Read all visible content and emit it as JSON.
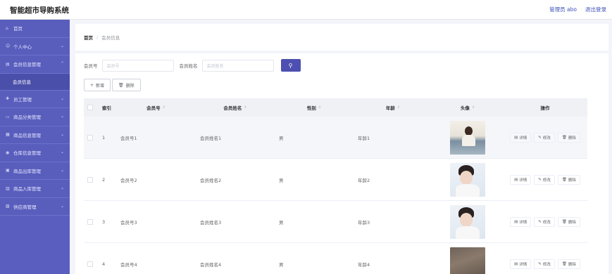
{
  "header": {
    "app_title": "智能超市导购系统",
    "admin_label": "管理员 abo",
    "logout_label": "退出登录"
  },
  "sidebar": {
    "items": [
      {
        "label": "首页",
        "icon": "home-icon",
        "has_chevron": false
      },
      {
        "label": "个人中心",
        "icon": "user-icon",
        "has_chevron": true
      },
      {
        "label": "会员信息管理",
        "icon": "list-icon",
        "has_chevron": true,
        "expanded": true
      },
      {
        "label": "员工管理",
        "icon": "staff-icon",
        "has_chevron": true
      },
      {
        "label": "商品分类管理",
        "icon": "category-icon",
        "has_chevron": true
      },
      {
        "label": "商品信息管理",
        "icon": "grid-icon",
        "has_chevron": true
      },
      {
        "label": "仓库信息管理",
        "icon": "warehouse-icon",
        "has_chevron": true
      },
      {
        "label": "商品出库管理",
        "icon": "outbound-icon",
        "has_chevron": true
      },
      {
        "label": "商品入库管理",
        "icon": "inbound-icon",
        "has_chevron": true
      },
      {
        "label": "供应商管理",
        "icon": "supplier-icon",
        "has_chevron": true
      }
    ],
    "submenu_active": "会员信息"
  },
  "breadcrumb": {
    "home": "首页",
    "separator": "/",
    "current": "会员信息"
  },
  "search": {
    "member_no_label": "会员号",
    "member_no_placeholder": "会员号",
    "member_name_label": "会员姓名",
    "member_name_placeholder": "会员姓名"
  },
  "actions": {
    "add_label": "新增",
    "delete_label": "删除"
  },
  "table": {
    "headers": {
      "index": "索引",
      "member_no": "会员号",
      "member_name": "会员姓名",
      "gender": "性别",
      "age": "年龄",
      "avatar": "头像",
      "ops": "操作"
    },
    "op_labels": {
      "detail": "详情",
      "edit": "修改",
      "delete": "删除"
    },
    "rows": [
      {
        "index": "1",
        "member_no": "会员号1",
        "member_name": "会员姓名1",
        "gender": "男",
        "age": "年龄1",
        "avatar": "avatar-photo-1"
      },
      {
        "index": "2",
        "member_no": "会员号2",
        "member_name": "会员姓名2",
        "gender": "男",
        "age": "年龄2",
        "avatar": "avatar-photo-2"
      },
      {
        "index": "3",
        "member_no": "会员号3",
        "member_name": "会员姓名3",
        "gender": "男",
        "age": "年龄3",
        "avatar": "avatar-photo-3"
      },
      {
        "index": "4",
        "member_no": "会员号4",
        "member_name": "会员姓名4",
        "gender": "男",
        "age": "年龄4",
        "avatar": "avatar-photo-4"
      }
    ]
  },
  "colors": {
    "sidebar_bg": "#5a5fbf",
    "sidebar_active_bg": "#4a4fa9",
    "primary": "#4d4fb1",
    "link": "#3b4fb8"
  }
}
